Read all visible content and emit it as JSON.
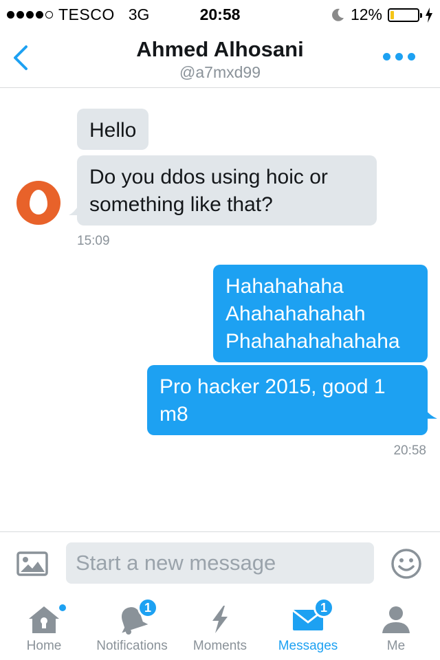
{
  "status_bar": {
    "carrier": "TESCO",
    "network": "3G",
    "time": "20:58",
    "battery": "12%",
    "battery_level": 0.12
  },
  "header": {
    "name": "Ahmed Alhosani",
    "handle": "@a7mxd99"
  },
  "messages": {
    "received": [
      "Hello",
      "Do you ddos using hoic or something like that?"
    ],
    "received_time": "15:09",
    "sent_1_lines": [
      "Hahahahaha",
      "Ahahahahahah",
      "Phahahahahahaha"
    ],
    "sent_2": "Pro hacker 2015, good 1 m8",
    "sent_time": "20:58"
  },
  "composer": {
    "placeholder": "Start a new message"
  },
  "tabs": {
    "home": "Home",
    "notifications": "Notifications",
    "notifications_badge": "1",
    "moments": "Moments",
    "messages": "Messages",
    "messages_badge": "1",
    "me": "Me"
  },
  "colors": {
    "accent": "#1da1f2",
    "incoming_bubble": "#e1e6ea",
    "avatar": "#e8622a"
  }
}
